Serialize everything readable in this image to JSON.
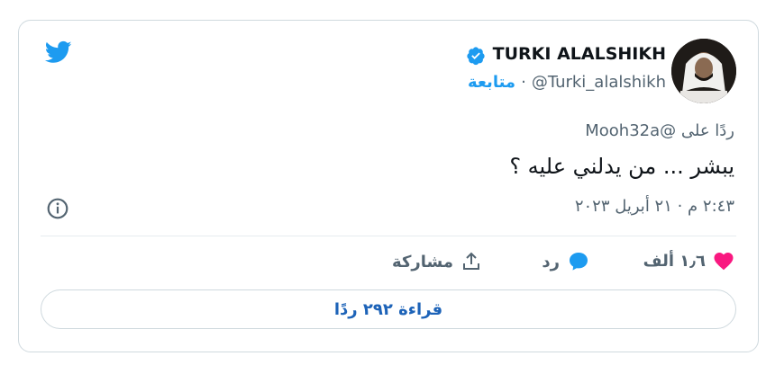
{
  "tweet": {
    "display_name": "TURKI ALALSHIKH",
    "handle": "@Turki_alalshikh",
    "follow_label": "متابعة",
    "reply_to": "ردًا على @Mooh32a",
    "text": "يبشر ... من يدلني عليه ؟",
    "timestamp": "٢:٤٣ م · ٢١ أبريل ٢٠٢٣"
  },
  "actions": {
    "like_count": "١٫٦ ألف",
    "reply_label": "رد",
    "share_label": "مشاركة"
  },
  "read_replies_label": "قراءة ٢٩٢ ردًا",
  "colors": {
    "accent": "#1d9bf0",
    "like": "#f91880",
    "muted": "#536471",
    "border": "#cfd9de"
  },
  "icons": [
    "twitter-logo-icon",
    "verified-badge-icon",
    "info-icon",
    "heart-icon",
    "reply-bubble-icon",
    "share-icon"
  ]
}
